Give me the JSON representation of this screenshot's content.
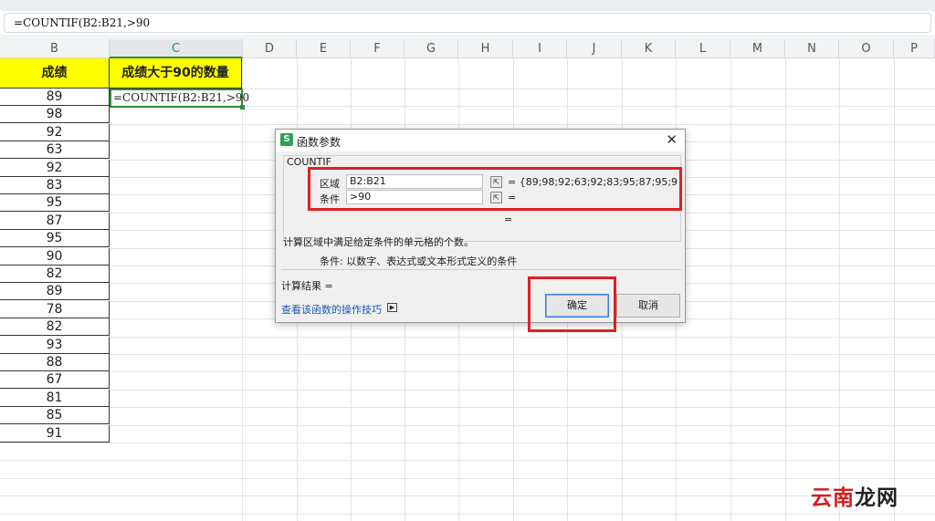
{
  "formula_bar": {
    "content": "=COUNTIF(B2:B21,>90"
  },
  "columns": [
    "B",
    "C",
    "D",
    "E",
    "F",
    "G",
    "H",
    "I",
    "J",
    "K",
    "L",
    "M",
    "N",
    "O",
    "P"
  ],
  "sheet": {
    "header_b": "成绩",
    "header_c": "成绩大于90的数量",
    "editing_cell": "=COUNTIF(B2:B21,>90",
    "scores": [
      "89",
      "98",
      "92",
      "63",
      "92",
      "83",
      "95",
      "87",
      "95",
      "90",
      "82",
      "89",
      "78",
      "82",
      "93",
      "88",
      "67",
      "81",
      "85",
      "91"
    ]
  },
  "dialog": {
    "title": "函数参数",
    "logo": "S",
    "function_name": "COUNTIF",
    "arg1_label": "区域",
    "arg1_value": "B2:B21",
    "arg1_result": "= {89;98;92;63;92;83;95;87;95;9...",
    "arg2_label": "条件",
    "arg2_value": ">90",
    "arg2_result": "=",
    "total_equals": "=",
    "description": "计算区域中满足给定条件的单元格的个数。",
    "arg_help": "条件:  以数字、表达式或文本形式定义的条件",
    "result_label": "计算结果 =",
    "help_link": "查看该函数的操作技巧",
    "ok_label": "确定",
    "cancel_label": "取消"
  },
  "watermark": {
    "part1": "云南",
    "part2": "龙网"
  },
  "colors": {
    "highlight": "#e02020",
    "header_fill": "#ffff00",
    "accent_green": "#2e8b3e"
  }
}
